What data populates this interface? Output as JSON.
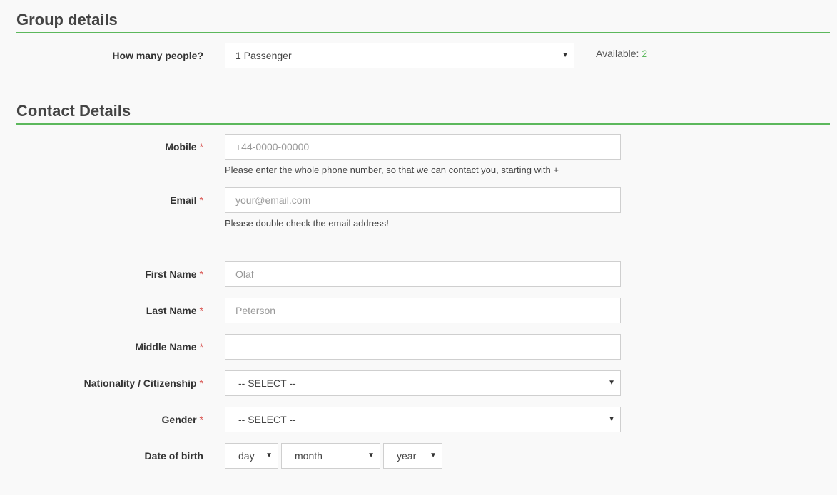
{
  "group": {
    "title": "Group details",
    "people_label": "How many people?",
    "people_value": "1 Passenger",
    "available_label": "Available:",
    "available_value": "2"
  },
  "contact": {
    "title": "Contact Details",
    "required_mark": "*",
    "mobile": {
      "label": "Mobile",
      "placeholder": "+44-0000-00000",
      "help": "Please enter the whole phone number, so that we can contact you, starting with +"
    },
    "email": {
      "label": "Email",
      "placeholder": "your@email.com",
      "help": "Please double check the email address!"
    },
    "first_name": {
      "label": "First Name",
      "placeholder": "Olaf"
    },
    "last_name": {
      "label": "Last Name",
      "placeholder": "Peterson"
    },
    "middle_name": {
      "label": "Middle Name",
      "placeholder": ""
    },
    "nationality": {
      "label": "Nationality / Citizenship",
      "value": "-- SELECT --"
    },
    "gender": {
      "label": "Gender",
      "value": "-- SELECT --"
    },
    "dob": {
      "label": "Date of birth",
      "day": "day",
      "month": "month",
      "year": "year"
    }
  },
  "icons": {
    "dropdown": "caret-down-icon",
    "caret_glyph": "▼"
  },
  "colors": {
    "accent": "#5cb85c",
    "required": "#d9534f"
  }
}
